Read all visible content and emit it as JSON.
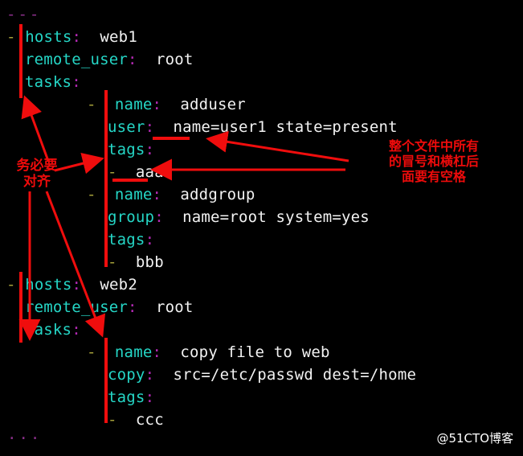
{
  "terminal": {
    "background": "#000000",
    "key_color": "#25d6c6",
    "colon_color": "#b429b4",
    "value_color": "#f2f2f2",
    "dash_color": "#a6a13a",
    "doc_marker_color": "#8b2f8b",
    "annotation_color": "#ee0b0b"
  },
  "code": {
    "doc_start": "---",
    "doc_end": "...",
    "lines": [
      {
        "indent": 0,
        "dash": "-",
        "key": "hosts",
        "colon": ":",
        "value": "web1"
      },
      {
        "indent": 1,
        "dash": "",
        "key": "remote_user",
        "colon": ":",
        "value": "root"
      },
      {
        "indent": 1,
        "dash": "",
        "key": "tasks",
        "colon": ":",
        "value": ""
      },
      {
        "indent": 5,
        "dash": "-",
        "key": "name",
        "colon": ":",
        "value": "adduser"
      },
      {
        "indent": 6,
        "dash": "",
        "key": "user",
        "colon": ":",
        "value": "name=user1 state=present"
      },
      {
        "indent": 6,
        "dash": "",
        "key": "tags",
        "colon": ":",
        "value": ""
      },
      {
        "indent": 6,
        "dash": "-",
        "key": "",
        "colon": "",
        "value": "aaa"
      },
      {
        "indent": 5,
        "dash": "-",
        "key": "name",
        "colon": ":",
        "value": "addgroup"
      },
      {
        "indent": 6,
        "dash": "",
        "key": "group",
        "colon": ":",
        "value": "name=root system=yes"
      },
      {
        "indent": 6,
        "dash": "",
        "key": "tags",
        "colon": ":",
        "value": ""
      },
      {
        "indent": 6,
        "dash": "-",
        "key": "",
        "colon": "",
        "value": "bbb"
      },
      {
        "indent": 0,
        "dash": "-",
        "key": "hosts",
        "colon": ":",
        "value": "web2"
      },
      {
        "indent": 1,
        "dash": "",
        "key": "remote_user",
        "colon": ":",
        "value": "root"
      },
      {
        "indent": 1,
        "dash": "",
        "key": "tasks",
        "colon": ":",
        "value": ""
      },
      {
        "indent": 5,
        "dash": "-",
        "key": "name",
        "colon": ":",
        "value": "copy file to web"
      },
      {
        "indent": 6,
        "dash": "",
        "key": "copy",
        "colon": ":",
        "value": "src=/etc/passwd dest=/home"
      },
      {
        "indent": 6,
        "dash": "",
        "key": "tags",
        "colon": ":",
        "value": ""
      },
      {
        "indent": 6,
        "dash": "-",
        "key": "",
        "colon": "",
        "value": "ccc"
      }
    ]
  },
  "annotations": {
    "alignment_note": "务必要\n对齐",
    "spacing_note": "整个文件中所有\n的冒号和横杠后\n面要有空格"
  },
  "watermark": {
    "text": "@51CTO博客"
  }
}
